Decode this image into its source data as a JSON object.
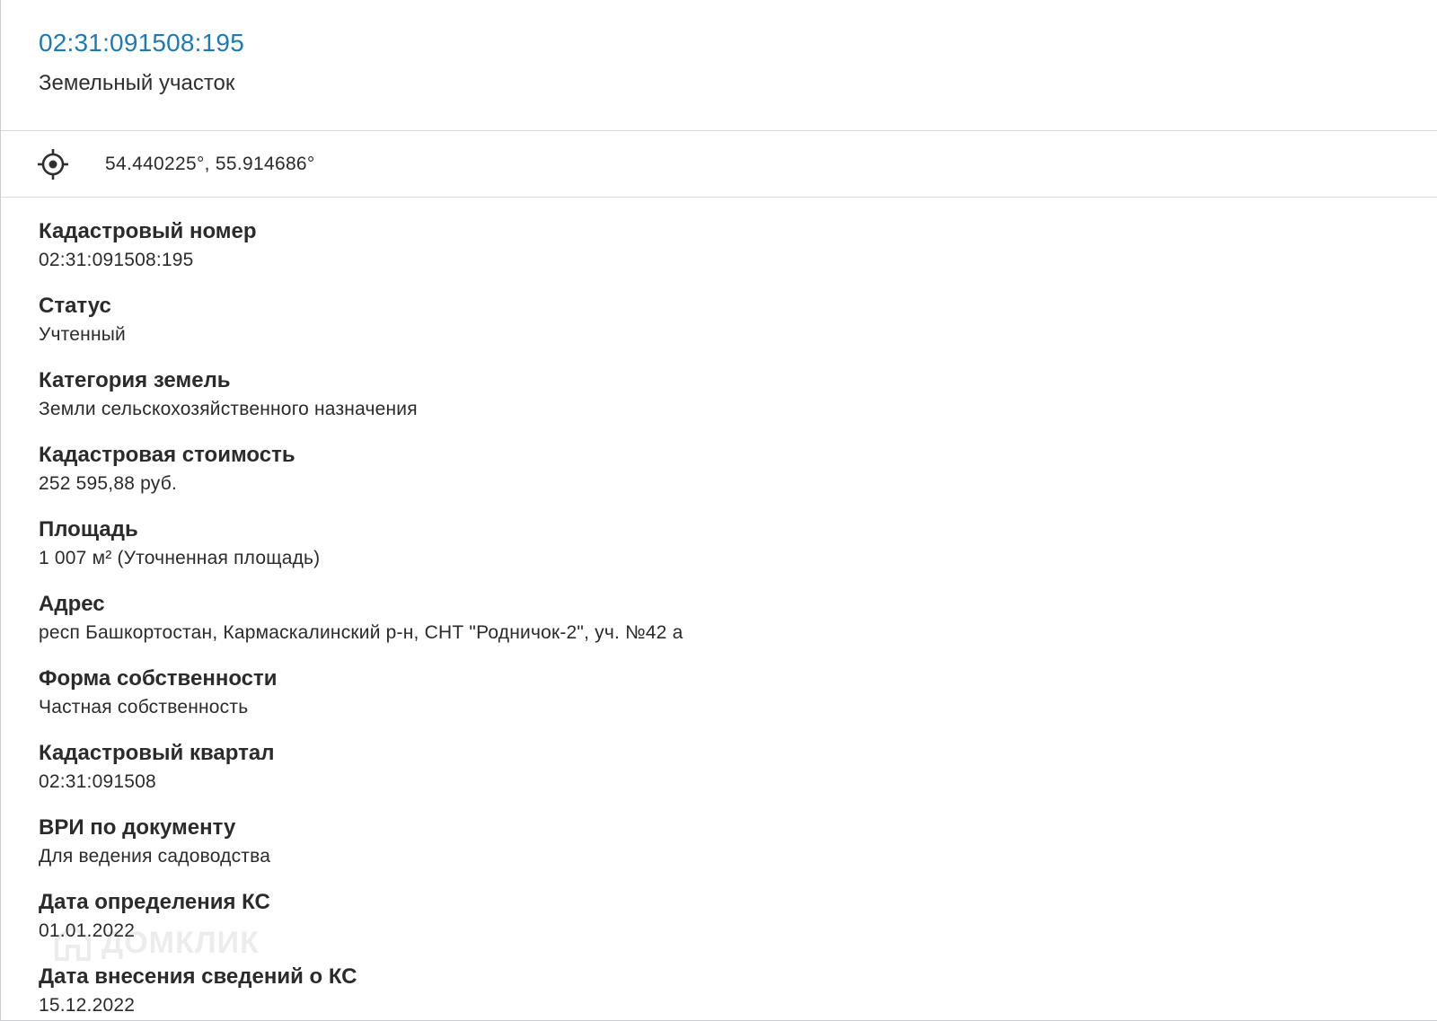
{
  "header": {
    "cadastral_link": "02:31:091508:195",
    "object_type": "Земельный участок"
  },
  "location": {
    "icon": "target-icon",
    "coordinates": "54.440225°, 55.914686°"
  },
  "fields": [
    {
      "label": "Кадастровый номер",
      "value": "02:31:091508:195"
    },
    {
      "label": "Статус",
      "value": "Учтенный"
    },
    {
      "label": "Категория земель",
      "value": "Земли сельскохозяйственного назначения"
    },
    {
      "label": "Кадастровая стоимость",
      "value": "252 595,88 руб."
    },
    {
      "label": "Площадь",
      "value": "1 007 м² (Уточненная площадь)"
    },
    {
      "label": "Адрес",
      "value": "респ Башкортостан, Кармаскалинский р-н, СНТ \"Родничок-2\", уч. №42 а"
    },
    {
      "label": "Форма собственности",
      "value": "Частная собственность"
    },
    {
      "label": "Кадастровый квартал",
      "value": "02:31:091508"
    },
    {
      "label": "ВРИ по документу",
      "value": "Для ведения садоводства"
    },
    {
      "label": "Дата определения КС",
      "value": "01.01.2022"
    },
    {
      "label": "Дата внесения сведений о КС",
      "value": "15.12.2022"
    }
  ],
  "watermark": {
    "text": "ДОМКЛИК",
    "icon": "house-logo-icon"
  },
  "colors": {
    "link": "#1b7bb8",
    "text": "#2b2b2b",
    "divider": "#d7dbdf"
  }
}
